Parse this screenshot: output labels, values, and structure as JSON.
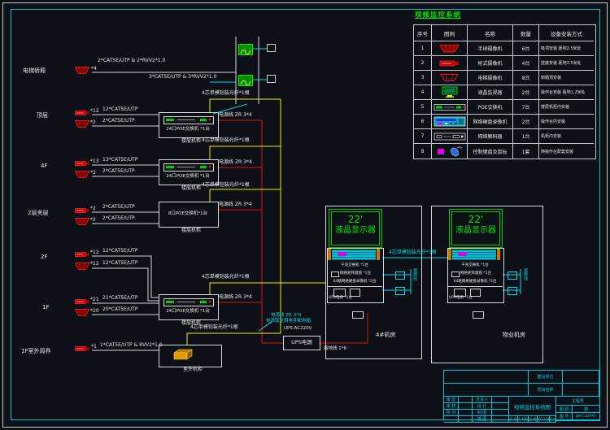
{
  "legend": {
    "title": "视频监控系统",
    "headers": [
      "序号",
      "图例",
      "名称",
      "数量",
      "设备安装方式"
    ],
    "rows": [
      {
        "no": "1",
        "name": "半球摄像机",
        "qty": "6台",
        "install": "吸顶安装 距地2.5米处"
      },
      {
        "no": "2",
        "name": "枪式摄像机",
        "qty": "4台",
        "install": "壁装安装 距地3.5米处"
      },
      {
        "no": "3",
        "name": "电梯摄像机",
        "qty": "8台",
        "install": "轿厢顶安装"
      },
      {
        "no": "4",
        "name": "液晶监视器",
        "qty": "2台",
        "install": "操作台安装 距地1.2米处"
      },
      {
        "no": "5",
        "name": "POE交换机",
        "qty": "7台",
        "install": "楼层机柜内安装"
      },
      {
        "no": "6",
        "name": "网络硬盘录像机",
        "qty": "2台",
        "install": "操作台内安装"
      },
      {
        "no": "7",
        "name": "网络解码器",
        "qty": "1台",
        "install": "机柜内安装"
      },
      {
        "no": "8",
        "name": "控制键盘及鼠标",
        "qty": "1套",
        "install": "随操作台配套安装"
      }
    ]
  },
  "riser": {
    "elevator": {
      "label": "电梯轿厢",
      "count": "*4",
      "cable": "2*CAT5E/UTP & 2*RVV2*1.0",
      "shaft_cable": "3*CAT5E/UTP & 3*RVV2*1.0"
    },
    "floors": [
      {
        "label": "顶层",
        "count1": "*12",
        "cable1": "12*CAT5E/UTP",
        "count2": "*2",
        "cable2": "2*CAT5E/UTP"
      },
      {
        "label": "4F",
        "count1": "*13",
        "cable1": "13*CAT5E/UTP",
        "count2": "*2",
        "cable2": "2*CAT5E/UTP"
      },
      {
        "label": "2层夹层",
        "count1": "*2",
        "cable1": "2*CAT5E/UTP",
        "count2": "*2",
        "cable2": "2*CAT5E/UTP"
      },
      {
        "label": "2F",
        "count1": "*12",
        "cable1": "12*CAT5E/UTP",
        "count2": "*12",
        "cable2": "12*CAT5E/UTP"
      },
      {
        "label": "1F",
        "count1": "*21",
        "cable1": "21*CAT5E/UTP",
        "count2": "*20",
        "cable2": "20*CAT5E/UTP"
      },
      {
        "label": "1F室外周界",
        "count1": "*1",
        "cable1": "1*CAT5E/UTP & RVV2*1.0"
      }
    ],
    "switches": [
      "24口POE交换机 *1台",
      "24口POE交换机 *1台",
      "8口POE交换机*1台",
      "24口POE交换机 *1台"
    ],
    "cabinet_label": "楼层机柜",
    "power_cable": "电源线 ZR 3*4",
    "fiber_cable": "4芯单模铠装光纤*1根",
    "outdoor_cabinet": "室外机柜"
  },
  "power": {
    "ups": "UPS电源",
    "note1": "电源线 ZR 3*4",
    "note2": "电源取至弱电井配电箱",
    "note3": "UPS AC220V",
    "ground": "接地线 1*6"
  },
  "stations": {
    "monitor_size": "22'",
    "monitor_name": "液晶显示器",
    "rack_rows": [
      "千兆交换机 *1台",
      "网络矩阵键盘 *1台",
      "64路网络硬盘录像机 *2台",
      "UPS电源 *1台"
    ],
    "link_fiber": "4芯单模铠装光纤*1根",
    "side_label": "视频线",
    "left_room": "4#机房",
    "right_room": "物业机房"
  },
  "titleblock": {
    "owner": "建设单位",
    "project": "项目名称",
    "r1c1": "审 定",
    "r1c2": "负责人",
    "r2c1": "审 核",
    "r2c2": "设 计",
    "r3c1": "校 对",
    "r3c2": "制 图",
    "r4c2": "描 图",
    "drawing_title": "视频监控系统图",
    "proj_no": "工程号",
    "sheet_type": "图 别",
    "sheet_type_v": "施",
    "sheet_no": "图 号",
    "sheet_no_v": "JW-CLDPXT",
    "scale": "比 例",
    "scale_v": "1:100",
    "date": "日 期",
    "date_v": "2012.06",
    "page": "页 次"
  }
}
